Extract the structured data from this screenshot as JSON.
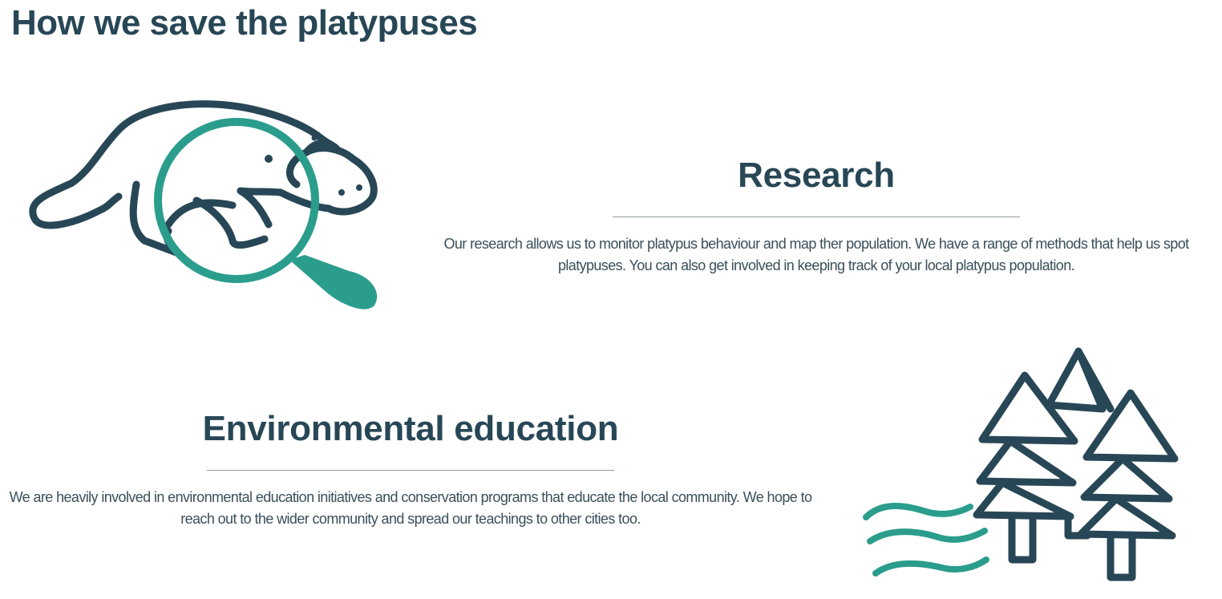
{
  "page": {
    "title": "How we save the platypuses"
  },
  "sections": {
    "research": {
      "heading": "Research",
      "body": "Our research allows us to monitor platypus behaviour and map ther population. We have a range of methods that help us spot platypuses. You can also get involved in keeping track of your local platypus population.",
      "icon": "platypus-magnifier-icon"
    },
    "education": {
      "heading": "Environmental education",
      "body": "We are heavily involved in environmental education initiatives and conservation programs that educate the local community. We hope to reach out to the wider community and spread our teachings to other cities too.",
      "icon": "trees-wind-icon"
    }
  },
  "colors": {
    "dark": "#284756",
    "accent": "#2b9d8c",
    "divider": "#8e9a9f",
    "background": "#ffffff"
  }
}
